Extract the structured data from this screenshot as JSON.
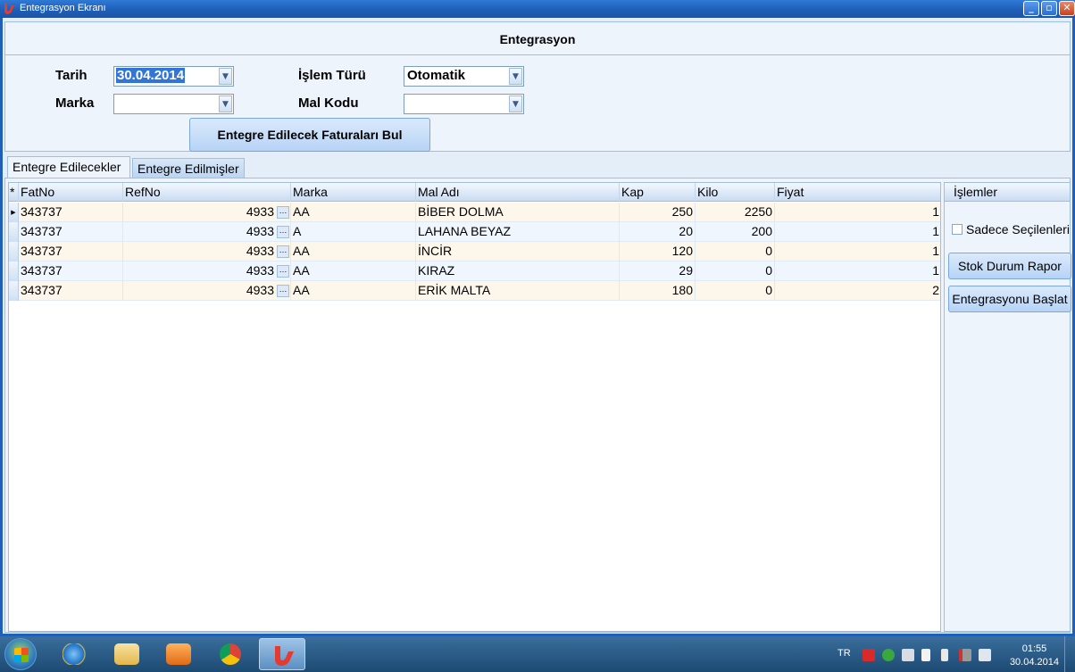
{
  "window": {
    "title": "Entegrasyon Ekranı"
  },
  "panel": {
    "title": "Entegrasyon",
    "tarih_label": "Tarih",
    "tarih_value": "30.04.2014",
    "islem_turu_label": "İşlem Türü",
    "islem_turu_value": "Otomatik",
    "marka_label": "Marka",
    "marka_value": "",
    "mal_kodu_label": "Mal Kodu",
    "mal_kodu_value": "",
    "find_button": "Entegre Edilecek Faturaları  Bul"
  },
  "tabs": [
    "Entegre Edilecekler",
    "Entegre Edilmişler"
  ],
  "grid": {
    "columns": [
      "FatNo",
      "RefNo",
      "Marka",
      "Mal Adı",
      "Kap",
      "Kilo",
      "Fiyat"
    ],
    "rows": [
      [
        "343737",
        "4933",
        "AA",
        "BİBER DOLMA",
        "250",
        "2250",
        "1"
      ],
      [
        "343737",
        "4933",
        "A",
        "LAHANA BEYAZ",
        "20",
        "200",
        "1"
      ],
      [
        "343737",
        "4933",
        "AA",
        "İNCİR",
        "120",
        "0",
        "1"
      ],
      [
        "343737",
        "4933",
        "AA",
        "KIRAZ",
        "29",
        "0",
        "1"
      ],
      [
        "343737",
        "4933",
        "AA",
        "ERİK MALTA",
        "180",
        "0",
        "2"
      ]
    ],
    "new_row_marker": "*"
  },
  "side": {
    "title": "İşlemler",
    "checkbox_label": "Sadece Seçilenleri",
    "stok_button": "Stok Durum Rapor",
    "start_button": "Entegrasyonu Başlat"
  },
  "taskbar": {
    "language": "TR",
    "time": "01:55",
    "date": "30.04.2014"
  },
  "colors": {
    "title_bar": "#1f5fb8",
    "panel_bg": "#eef4fc",
    "row_odd": "#fdf6ea",
    "row_even": "#f0f6fd",
    "selection": "#3375d6"
  }
}
